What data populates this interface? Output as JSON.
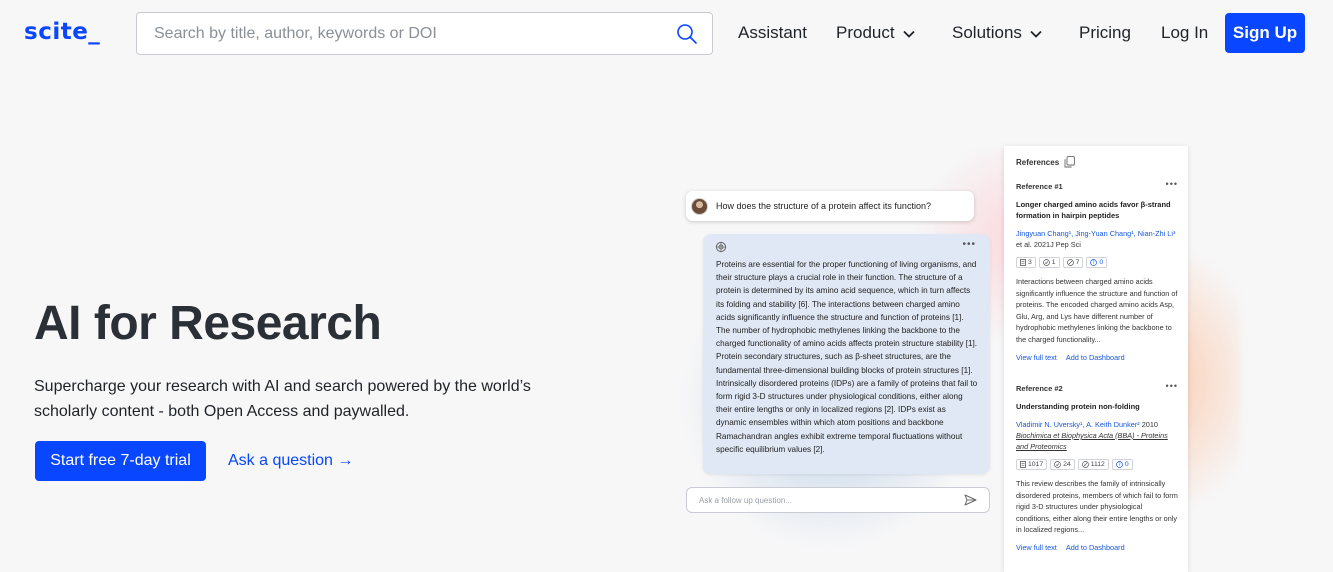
{
  "brand": {
    "logo": "scite_",
    "color": "#0846ff"
  },
  "search": {
    "placeholder": "Search by title, author, keywords or DOI",
    "value": ""
  },
  "nav": {
    "assistant": "Assistant",
    "product": "Product",
    "solutions": "Solutions",
    "pricing": "Pricing",
    "login": "Log In",
    "signup": "Sign Up"
  },
  "hero": {
    "title": "AI for Research",
    "subtitle": "Supercharge your research with AI and search powered by the world’s scholarly content - both Open Access and paywalled.",
    "cta_primary": "Start free 7-day trial",
    "cta_secondary": "Ask a question →"
  },
  "chat": {
    "question": "How does the structure of a protein affect its function?",
    "answer": "Proteins are essential for the proper functioning of living organisms, and their structure plays a crucial role in their function. The structure of a protein is determined by its amino acid sequence, which in turn affects its folding and stability [6]. The interactions between charged amino acids significantly influence the structure and function of proteins [1]. The number of hydrophobic methylenes linking the backbone to the charged functionality of amino acids affects protein structure stability [1]. Protein secondary structures, such as β-sheet structures, are the fundamental three-dimensional building blocks of protein structures [1]. Intrinsically disordered proteins (IDPs) are a family of proteins that fail to form rigid 3-D structures under physiological conditions, either along their entire lengths or only in localized regions [2]. IDPs exist as dynamic ensembles within which atom positions and backbone Ramachandran angles exhibit extreme temporal fluctuations without specific equilibrium values [2].",
    "more": "•••",
    "followup_placeholder": "Ask a follow up question..."
  },
  "references": {
    "heading": "References",
    "items": [
      {
        "num": "Reference #1",
        "more": "•••",
        "title": "Longer charged amino acids favor β-strand formation in hairpin peptides",
        "authors_linked": "Jingyuan Chang¹, Jing-Yuan Chang¹, Nian-Zhi Li³",
        "authors_rest": " et al. 2021J Pep Sci",
        "journal": "",
        "badges": [
          "3",
          "1",
          "7",
          "0"
        ],
        "description": "Interactions between charged amino acids significantly influence the structure and function of proteins. The encoded charged amino acids Asp, Glu, Arg, and Lys have different number of hydrophobic methylenes linking the backbone to the charged functionality...",
        "link_full": "View full text",
        "link_dash": "Add to Dashboard"
      },
      {
        "num": "Reference #2",
        "more": "•••",
        "title": "Understanding protein non-folding",
        "authors_linked": "Vladimir N. Uversky¹, A. Keith Dunker²",
        "authors_rest": " 2010",
        "journal": "Biochimica et Biophysica Acta (BBA) - Proteins and Proteomics",
        "badges": [
          "1017",
          "24",
          "1112",
          "0"
        ],
        "description": "This review describes the family of intrinsically disordered proteins, members of which fail to form rigid 3-D structures under physiological conditions, either along their entire lengths or only in localized regions...",
        "link_full": "View full text",
        "link_dash": "Add to Dashboard"
      }
    ]
  }
}
